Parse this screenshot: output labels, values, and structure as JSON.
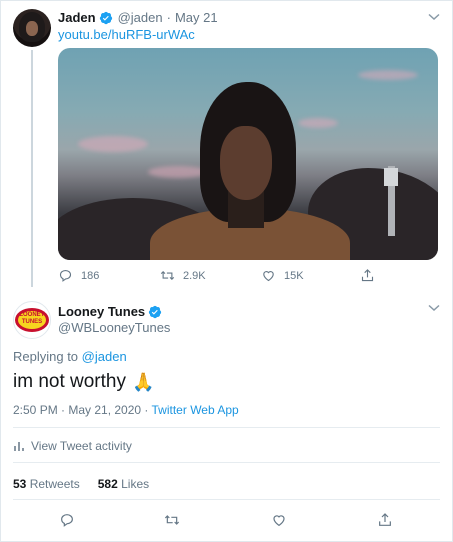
{
  "tweet1": {
    "name": "Jaden",
    "handle": "@jaden",
    "date": "May 21",
    "link": "youtu.be/huRFB-urWAc",
    "actions": {
      "replies": "186",
      "retweets": "2.9K",
      "likes": "15K"
    },
    "icons": [
      "verified-icon",
      "chevron-down-icon",
      "reply-icon",
      "retweet-icon",
      "like-icon",
      "share-icon"
    ]
  },
  "tweet2": {
    "name": "Looney Tunes",
    "handle": "@WBLooneyTunes",
    "replying_prefix": "Replying to",
    "replying_to": "@jaden",
    "text": "im not worthy",
    "emoji": "🙏",
    "timestamp": "2:50 PM · May 21, 2020 · ",
    "app": "Twitter Web App",
    "activity_label": "View Tweet activity",
    "retweets_count": "53",
    "retweets_label": "Retweets",
    "likes_count": "582",
    "likes_label": "Likes",
    "avatar_text": "LOONEY TUNES"
  },
  "colors": {
    "link": "#1b95e0",
    "secondary_text": "#657786",
    "primary_text": "#14171a",
    "verified": "#1da1f2",
    "divider": "#e6ecf0"
  }
}
